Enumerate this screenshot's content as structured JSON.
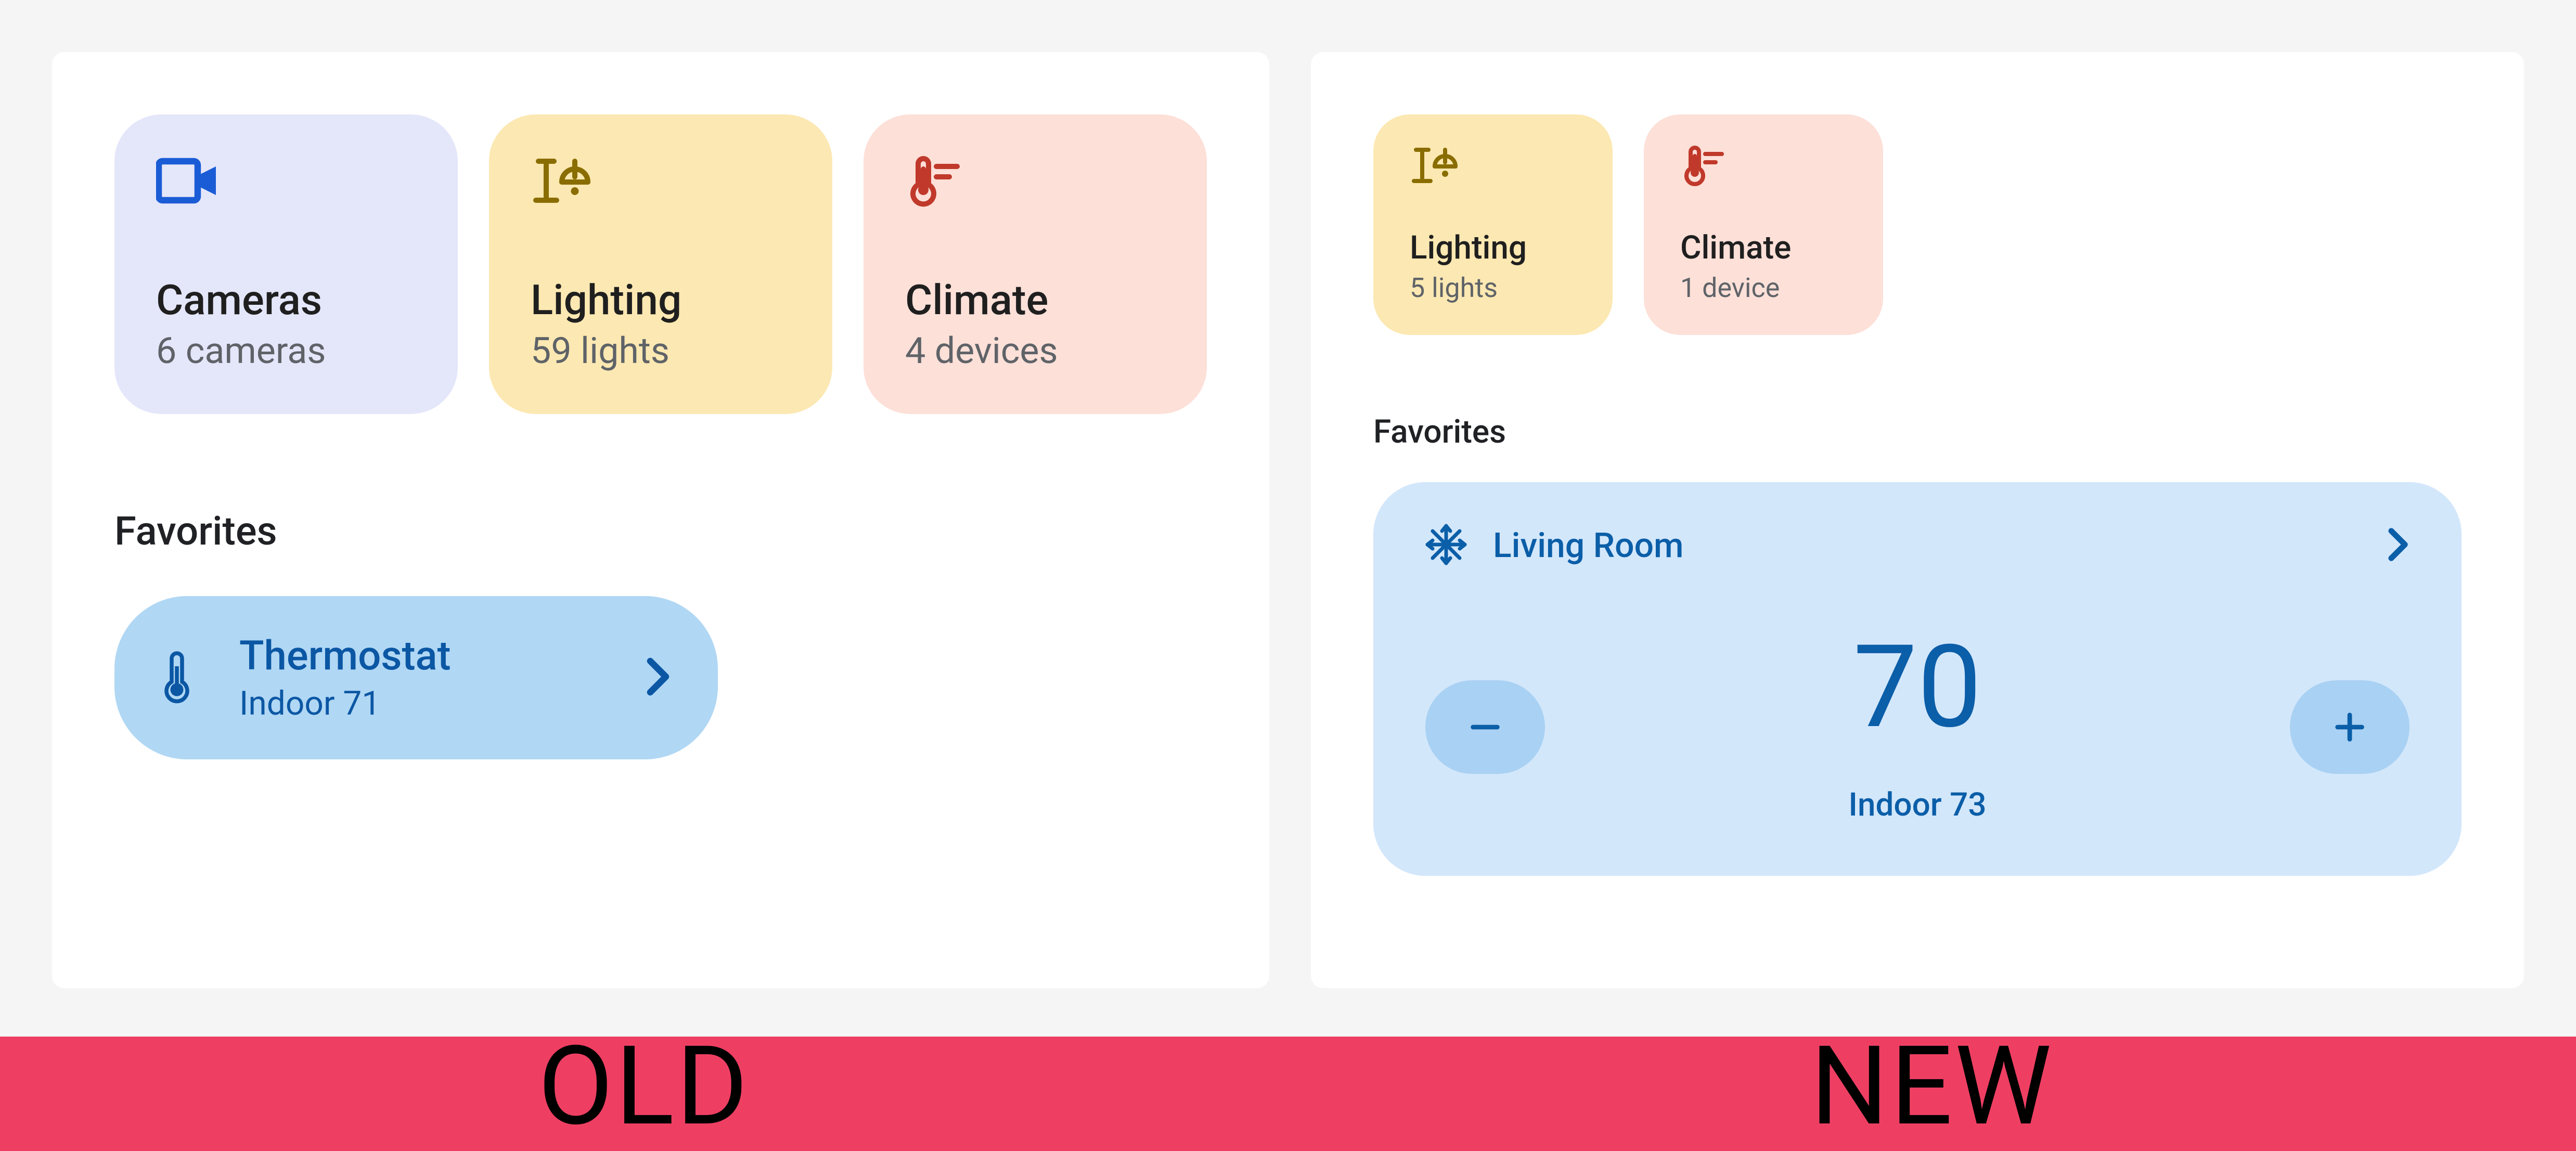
{
  "old": {
    "tiles": [
      {
        "id": "cameras",
        "title": "Cameras",
        "subtitle": "6 cameras"
      },
      {
        "id": "lighting",
        "title": "Lighting",
        "subtitle": "59 lights"
      },
      {
        "id": "climate",
        "title": "Climate",
        "subtitle": "4 devices"
      }
    ],
    "favorites_heading": "Favorites",
    "thermostat": {
      "title": "Thermostat",
      "subtitle": "Indoor 71"
    }
  },
  "new": {
    "tiles": [
      {
        "id": "lighting",
        "title": "Lighting",
        "subtitle": "5 lights"
      },
      {
        "id": "climate",
        "title": "Climate",
        "subtitle": "1 device"
      }
    ],
    "favorites_heading": "Favorites",
    "living_room": {
      "name": "Living Room",
      "setpoint": "70",
      "indoor": "Indoor 73"
    }
  },
  "labels": {
    "old": "OLD",
    "new": "NEW"
  }
}
